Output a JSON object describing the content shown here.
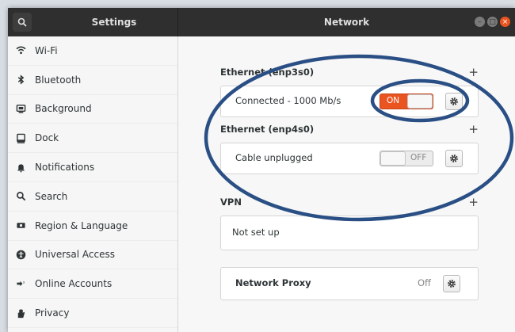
{
  "header": {
    "sidebar_title": "Settings",
    "title": "Network"
  },
  "sidebar": {
    "items": [
      {
        "label": "Wi-Fi",
        "icon": "wifi-icon"
      },
      {
        "label": "Bluetooth",
        "icon": "bluetooth-icon"
      },
      {
        "label": "Background",
        "icon": "background-icon"
      },
      {
        "label": "Dock",
        "icon": "dock-icon"
      },
      {
        "label": "Notifications",
        "icon": "bell-icon"
      },
      {
        "label": "Search",
        "icon": "search-icon"
      },
      {
        "label": "Region & Language",
        "icon": "region-icon"
      },
      {
        "label": "Universal Access",
        "icon": "accessibility-icon"
      },
      {
        "label": "Online Accounts",
        "icon": "online-accounts-icon"
      },
      {
        "label": "Privacy",
        "icon": "hand-icon"
      }
    ]
  },
  "main": {
    "ethernet1": {
      "title": "Ethernet (enp3s0)",
      "plus": "+",
      "status": "Connected - 1000 Mb/s",
      "switch_label": "ON",
      "switch_state": true
    },
    "ethernet2": {
      "title": "Ethernet (enp4s0)",
      "plus": "+",
      "status": "Cable unplugged",
      "switch_label": "OFF",
      "switch_state": false
    },
    "vpn": {
      "title": "VPN",
      "plus": "+",
      "status": "Not set up"
    },
    "proxy": {
      "label": "Network Proxy",
      "value": "Off"
    }
  },
  "colors": {
    "accent": "#e95420",
    "annotation": "#2a4f85",
    "headerbar": "#2f2f2f"
  }
}
